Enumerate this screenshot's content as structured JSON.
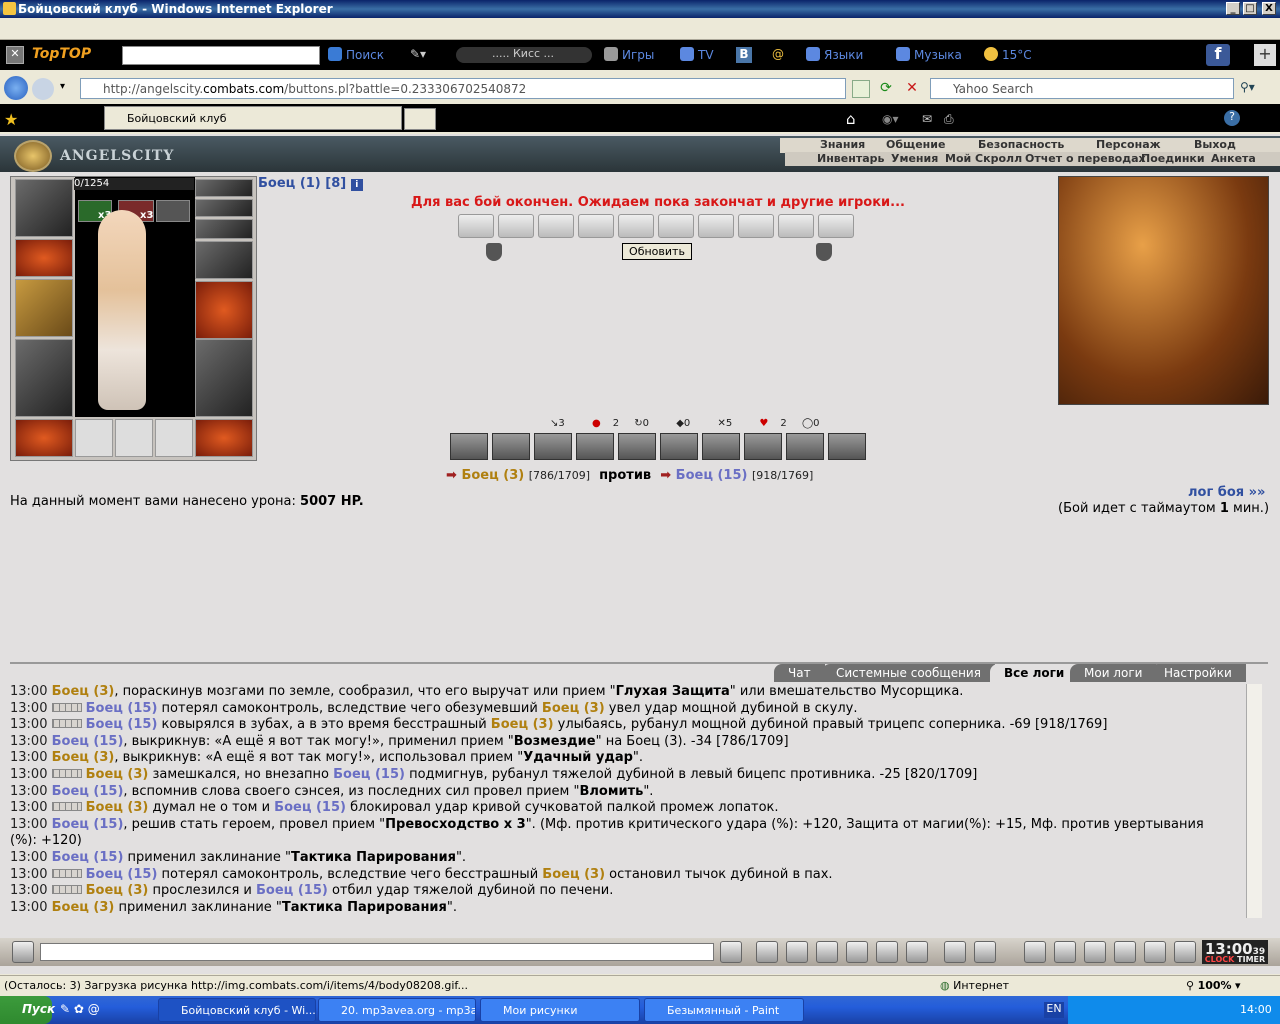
{
  "window": {
    "title": "Бойцовский клуб - Windows Internet Explorer",
    "min": "_",
    "max": "□",
    "close": "X"
  },
  "toolbar": {
    "brand": "TopTOP",
    "search": "Поиск",
    "player": "..... Кисс ...",
    "games": "Игры",
    "tv": "TV",
    "vk": "B",
    "languages": "Языки",
    "music": "Музыка",
    "weather": "15°C"
  },
  "address": {
    "url_prefix": "http://angelscity.",
    "url_domain": "combats.com",
    "url_suffix": "/buttons.pl?battle=0.233306702540872",
    "search_placeholder": "Yahoo Search"
  },
  "tabs": {
    "active": "Бойцовский клуб"
  },
  "site": {
    "logo": "ANGELSCITY",
    "menu": [
      "Знания",
      "Общение",
      "Безопасность",
      "Персонаж",
      "Выход"
    ],
    "submenu": [
      "Инвентарь",
      "Умения",
      "Мой Скролл",
      "Отчет о переводах",
      "Поединки",
      "Анкета"
    ]
  },
  "character": {
    "hp": "0/1254",
    "effect1": "x3",
    "effect2": "x3",
    "name": "Боец (1) [8]",
    "info": "i"
  },
  "battle": {
    "message": "Для вас бой окончен. Ожидаем пока закончат и другие игроки...",
    "refresh": "Обновить",
    "stats": [
      "3",
      "2",
      "0",
      "0",
      "5",
      "2",
      "0"
    ],
    "player1": "Боец (3)",
    "player1_hp": "[786/1709]",
    "vs": "против",
    "player2": "Боец (15)",
    "player2_hp": "[918/1769]",
    "damage_label": "На данный момент вами нанесено урона:",
    "damage_value": "5007 HP.",
    "log_link": "лог боя »»",
    "timeout_prefix": "(Бой идет с таймаутом ",
    "timeout_value": "1",
    "timeout_suffix": " мин.)"
  },
  "log_tabs": [
    "Чат",
    "Системные сообщения",
    "Все логи",
    "Мои логи",
    "Настройки"
  ],
  "log": [
    {
      "time": "13:00",
      "a": "Боец (3)",
      "t1": ", пораскинув мозгами по земле, сообразил, что его выручат или прием \"",
      "b": "Глухая Защита",
      "t2": "\" или вмешательство Мусорщика."
    },
    {
      "time": "13:00",
      "a": "Боец (15)",
      "t1": " потерял самоконтроль, вследствие чего обезумевший ",
      "b": "Боец (3)",
      "t2": " увел удар мощной дубиной в скулу."
    },
    {
      "time": "13:00",
      "a": "Боец (15)",
      "t1": " ковырялся в зубах, а в это время бесстрашный ",
      "b": "Боец (3)",
      "t2": " улыбаясь, рубанул мощной дубиной правый трицепс соперника. -69 [918/1769]"
    },
    {
      "time": "13:00",
      "a": "Боец (15)",
      "t1": ", выкрикнув: «А ещё я вот так могу!», применил прием \"",
      "b": "Возмездие",
      "t2": "\" на Боец (3). -34 [786/1709]"
    },
    {
      "time": "13:00",
      "a": "Боец (3)",
      "t1": ", выкрикнув: «А ещё я вот так могу!», использовал прием \"",
      "b": "Удачный удар",
      "t2": "\"."
    },
    {
      "time": "13:00",
      "a": "Боец (3)",
      "t1": " замешкался, но внезапно ",
      "b": "Боец (15)",
      "t2": " подмигнув, рубанул тяжелой дубиной в левый бицепс противника. -25 [820/1709]"
    },
    {
      "time": "13:00",
      "a": "Боец (15)",
      "t1": ", вспомнив слова своего сэнсея, из последних сил провел прием \"",
      "b": "Вломить",
      "t2": "\"."
    },
    {
      "time": "13:00",
      "a": "Боец (3)",
      "t1": " думал не о том и ",
      "b": "Боец (15)",
      "t2": " блокировал удар кривой сучковатой палкой промеж лопаток."
    },
    {
      "time": "13:00",
      "a": "Боец (15)",
      "t1": ", решив стать героем, провел прием \"",
      "b": "Превосходство х 3",
      "t2": "\". (Мф. против критического удара (%): +120, Защита от магии(%): +15, Мф. против увертывания"
    },
    {
      "time": "",
      "a": "",
      "t1": "(%): +120)",
      "b": "",
      "t2": ""
    },
    {
      "time": "13:00",
      "a": "Боец (15)",
      "t1": " применил заклинание \"",
      "b": "Тактика Парирования",
      "t2": "\"."
    },
    {
      "time": "13:00",
      "a": "Боец (15)",
      "t1": " потерял самоконтроль, вследствие чего бесстрашный ",
      "b": "Боец (3)",
      "t2": " остановил тычок дубиной в пах."
    },
    {
      "time": "13:00",
      "a": "Боец (3)",
      "t1": " прослезился и ",
      "b": "Боец (15)",
      "t2": " отбил удар тяжелой дубиной по печени."
    },
    {
      "time": "13:00",
      "a": "Боец (3)",
      "t1": " применил заклинание \"",
      "b": "Тактика Парирования",
      "t2": "\"."
    }
  ],
  "clock": {
    "time": "13:00",
    "sec": "39",
    "clock": "CLOCK",
    "timer": "TIMER"
  },
  "status": {
    "text": "(Осталось: 3) Загрузка рисунка http://img.combats.com/i/items/4/body08208.gif...",
    "zone": "Интернет",
    "zoom": "100%"
  },
  "taskbar": {
    "start": "Пуск",
    "tasks": [
      "Бойцовский клуб - Wi...",
      "20. mp3avea.org - mp3a...",
      "Мои рисунки",
      "Безымянный - Paint"
    ],
    "lang": "EN",
    "time": "14:00"
  }
}
